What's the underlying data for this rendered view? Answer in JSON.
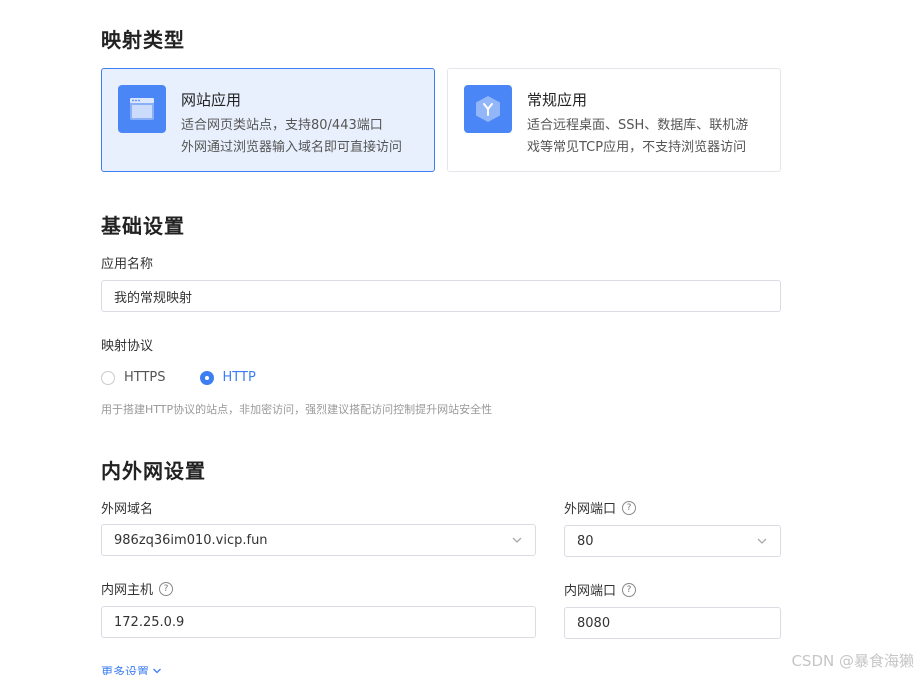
{
  "sections": {
    "mapping_type": "映射类型",
    "basic_settings": "基础设置",
    "network_settings": "内外网设置"
  },
  "mapping_types": [
    {
      "title": "网站应用",
      "desc_line1": "适合网页类站点，支持80/443端口",
      "desc_line2": "外网通过浏览器输入域名即可直接访问",
      "selected": true,
      "icon": "browser-window-icon"
    },
    {
      "title": "常规应用",
      "desc_line1": "适合远程桌面、SSH、数据库、联机游",
      "desc_line2": "戏等常见TCP应用，不支持浏览器访问",
      "selected": false,
      "icon": "cube-icon"
    }
  ],
  "basic": {
    "app_name_label": "应用名称",
    "app_name_value": "我的常规映射",
    "protocol_label": "映射协议",
    "protocol_options": [
      "HTTPS",
      "HTTP"
    ],
    "protocol_selected": "HTTP",
    "protocol_hint": "用于搭建HTTP协议的站点，非加密访问，强烈建议搭配访问控制提升网站安全性"
  },
  "network": {
    "external_domain_label": "外网域名",
    "external_domain_value": "986zq36im010.vicp.fun",
    "external_port_label": "外网端口",
    "external_port_value": "80",
    "internal_host_label": "内网主机",
    "internal_host_value": "172.25.0.9",
    "internal_port_label": "内网端口",
    "internal_port_value": "8080",
    "help_glyph": "?"
  },
  "more_settings": "更多设置",
  "watermark": "CSDN @暴食海獭",
  "colors": {
    "accent": "#3d7ef3",
    "icon_bg": "#4b86f6",
    "selected_card_bg": "#e9f0fd"
  }
}
